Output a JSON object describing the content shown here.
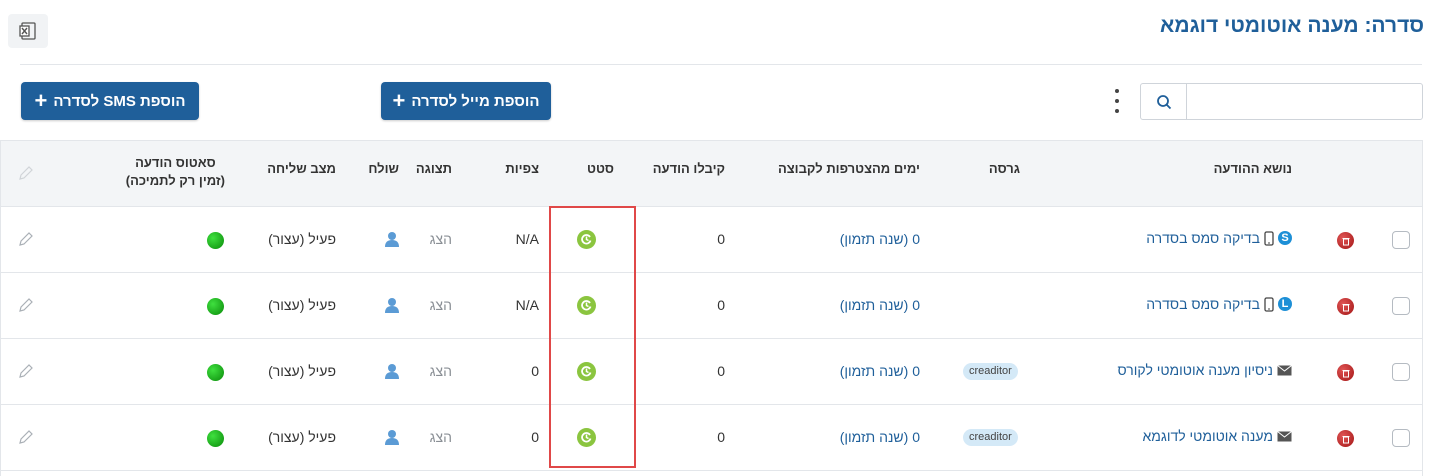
{
  "page": {
    "title": "סדרה: מענה אוטומטי דוגמא"
  },
  "toolbar": {
    "add_sms_label": "הוספת SMS לסדרה",
    "add_mail_label": "הוספת מייל לסדרה",
    "search_placeholder": "",
    "excel_icon": "excel-export-icon"
  },
  "table": {
    "headers": {
      "subject": "נושא ההודעה",
      "version": "גרסה",
      "days": "ימים מהצטרפות לקבוצה",
      "received": "קיבלו הודעה",
      "set": "סטט",
      "views": "צפיות",
      "display": "תצוגה",
      "sender": "שולח",
      "send_state": "מצב שליחה",
      "status_line1": "סאטוס הודעה",
      "status_line2": "(זמין רק לתמיכה)"
    },
    "rows": [
      {
        "subject": "בדיקה סמס בסדרה",
        "type": "sms",
        "badge": "S",
        "version": "",
        "days": "0 (שנה תזמון)",
        "received": "0",
        "views": "N/A",
        "display": "הצג",
        "send_state": "פעיל (עצור)"
      },
      {
        "subject": "בדיקה סמס בסדרה",
        "type": "sms",
        "badge": "L",
        "version": "",
        "days": "0 (שנה תזמון)",
        "received": "0",
        "views": "N/A",
        "display": "הצג",
        "send_state": "פעיל (עצור)"
      },
      {
        "subject": "ניסיון מענה אוטומטי לקורס",
        "type": "mail",
        "badge": "",
        "version": "creaditor",
        "days": "0 (שנה תזמון)",
        "received": "0",
        "views": "0",
        "display": "הצג",
        "send_state": "פעיל (עצור)"
      },
      {
        "subject": "מענה אוטומטי לדוגמא",
        "type": "mail",
        "badge": "",
        "version": "creaditor",
        "days": "0 (שנה תזמון)",
        "received": "0",
        "views": "0",
        "display": "הצג",
        "send_state": "פעיל (עצור)"
      }
    ]
  },
  "colors": {
    "brand": "#1f5f9a",
    "status_active": "#1cc41c",
    "highlight": "#e04848"
  }
}
